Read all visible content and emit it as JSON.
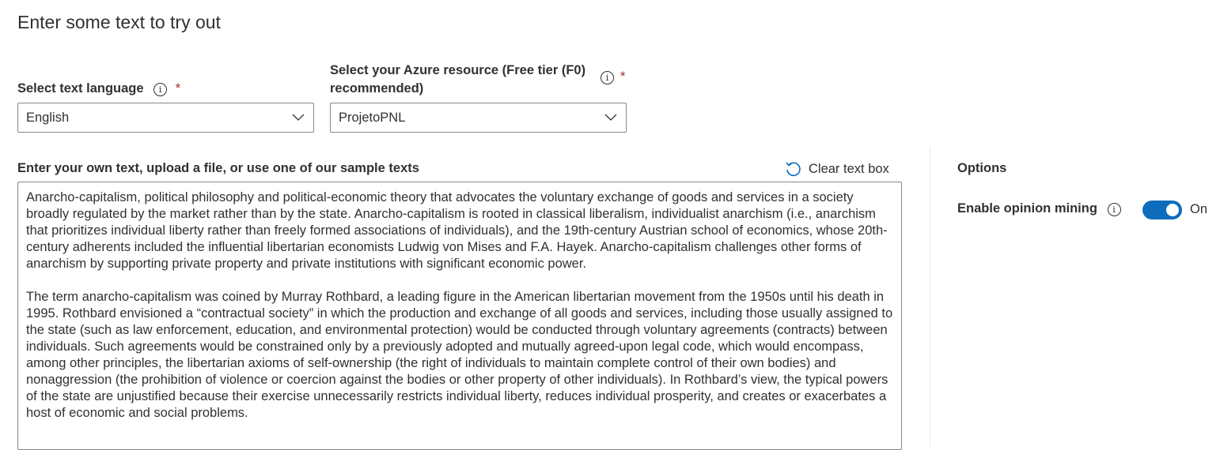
{
  "page": {
    "title": "Enter some text to try out"
  },
  "language": {
    "label": "Select text language",
    "required_mark": "*",
    "selected": "English"
  },
  "resource": {
    "label_line1": "Select your Azure resource (Free tier (F0)",
    "label_line2": "recommended)",
    "required_mark": "*",
    "selected": "ProjetoPNL"
  },
  "textbox": {
    "label": "Enter your own text, upload a file, or use one of our sample texts",
    "clear_label": "Clear text box",
    "paragraphs": [
      "Anarcho-capitalism, political philosophy and political-economic theory that advocates the voluntary exchange of goods and services in a society broadly regulated by the market rather than by the state. Anarcho-capitalism is rooted in classical liberalism, individualist anarchism (i.e., anarchism that prioritizes individual liberty rather than freely formed associations of individuals), and the 19th-century Austrian school of economics, whose 20th-century adherents included the influential libertarian economists Ludwig von Mises and F.A. Hayek. Anarcho-capitalism challenges other forms of anarchism by supporting private property and private institutions with significant economic power.",
      "The term anarcho-capitalism was coined by Murray Rothbard, a leading figure in the American libertarian movement from the 1950s until his death in 1995. Rothbard envisioned a “contractual society” in which the production and exchange of all goods and services, including those usually assigned to the state (such as law enforcement, education, and environmental protection) would be conducted through voluntary agreements (contracts) between individuals. Such agreements would be constrained only by a previously adopted and mutually agreed-upon legal code, which would encompass, among other principles, the libertarian axioms of self-ownership (the right of individuals to maintain complete control of their own bodies) and nonaggression (the prohibition of violence or coercion against the bodies or other property of other individuals). In Rothbard’s view, the typical powers of the state are unjustified because their exercise unnecessarily restricts individual liberty, reduces individual prosperity, and creates or exacerbates a host of economic and social problems."
    ]
  },
  "options": {
    "heading": "Options",
    "opinion_mining_label": "Enable opinion mining",
    "toggle_state": "On",
    "toggle_on": true,
    "accent_color": "#0f6cbd"
  },
  "icons": {
    "info": "info-icon",
    "chevron": "chevron-down-icon",
    "clear": "undo-icon"
  }
}
